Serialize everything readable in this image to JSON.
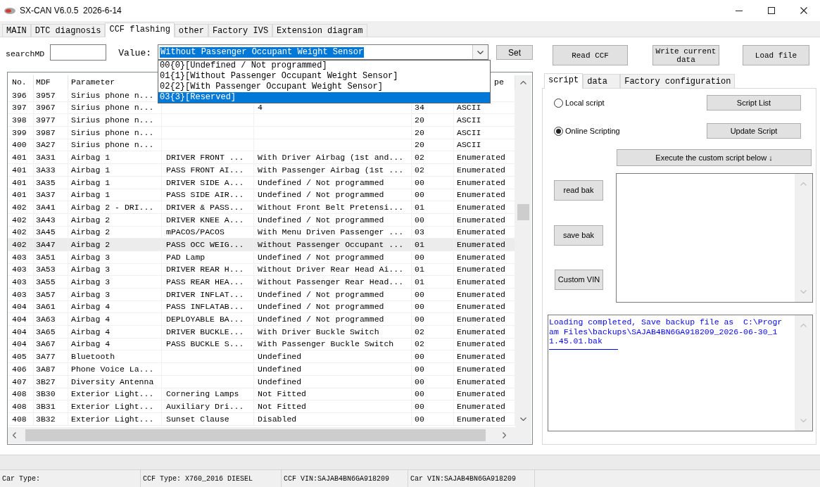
{
  "window": {
    "title": "SX-CAN V6.0.5  2026-6-14"
  },
  "tabs": [
    {
      "label": "MAIN",
      "selected": false
    },
    {
      "label": "DTC diagnosis",
      "selected": false
    },
    {
      "label": "CCF flashing",
      "selected": true
    },
    {
      "label": "other",
      "selected": false
    },
    {
      "label": "Factory IVS",
      "selected": false
    },
    {
      "label": "Extension diagram",
      "selected": false
    }
  ],
  "search": {
    "label": "searchMD"
  },
  "value_field": {
    "label": "Value:",
    "value": "Without Passenger Occupant Weight Sensor",
    "highlighted": true,
    "expanded": true,
    "options": [
      {
        "text": "00{0}[Undefined / Not programmed]",
        "selected": false
      },
      {
        "text": "01{1}[Without Passenger Occupant Weight Sensor]",
        "selected": false
      },
      {
        "text": "02{2}[With Passenger Occupant Weight Sensor]",
        "selected": false
      },
      {
        "text": "03{3}[Reserved]",
        "selected": true
      }
    ]
  },
  "set_button": "Set",
  "action_buttons": [
    "Read CCF",
    "Write current data",
    "Load file"
  ],
  "table": {
    "columns": {
      "no": "No.",
      "mdf": "MDF",
      "parameter": "Parameter",
      "column_7": "pe"
    },
    "rows": [
      {
        "no": "396",
        "mdf": "3957",
        "parameter": "Sirius phone n...",
        "selected": false
      },
      {
        "no": "397",
        "mdf": "3967",
        "parameter": "Sirius phone n...",
        "column_5": "4",
        "column_6": "34",
        "column_7": "ASCII",
        "selected": false
      },
      {
        "no": "398",
        "mdf": "3977",
        "parameter": "Sirius phone n...",
        "column_6": "20",
        "column_7": "ASCII",
        "selected": false
      },
      {
        "no": "399",
        "mdf": "3987",
        "parameter": "Sirius phone n...",
        "column_6": "20",
        "column_7": "ASCII",
        "selected": false
      },
      {
        "no": "400",
        "mdf": "3A27",
        "parameter": "Sirius phone n...",
        "column_6": "20",
        "column_7": "ASCII",
        "selected": false
      },
      {
        "no": "401",
        "mdf": "3A31",
        "parameter": "Airbag 1",
        "column_4": "DRIVER FRONT ...",
        "column_5": "With Driver Airbag (1st and...",
        "column_6": "02",
        "column_7": "Enumerated",
        "selected": false
      },
      {
        "no": "401",
        "mdf": "3A33",
        "parameter": "Airbag 1",
        "column_4": "PASS FRONT AI...",
        "column_5": "With Passenger Airbag (1st ...",
        "column_6": "02",
        "column_7": "Enumerated",
        "selected": false
      },
      {
        "no": "401",
        "mdf": "3A35",
        "parameter": "Airbag 1",
        "column_4": "DRIVER SIDE A...",
        "column_5": "Undefined / Not programmed",
        "column_6": "00",
        "column_7": "Enumerated",
        "selected": false
      },
      {
        "no": "401",
        "mdf": "3A37",
        "parameter": "Airbag 1",
        "column_4": "PASS SIDE AIR...",
        "column_5": "Undefined / Not programmed",
        "column_6": "00",
        "column_7": "Enumerated",
        "selected": false
      },
      {
        "no": "402",
        "mdf": "3A41",
        "parameter": "Airbag 2 - DRI...",
        "column_4": "DRIVER & PASS...",
        "column_5": "Without Front Belt Pretensi...",
        "column_6": "01",
        "column_7": "Enumerated",
        "selected": false
      },
      {
        "no": "402",
        "mdf": "3A43",
        "parameter": "Airbag 2",
        "column_4": "DRIVER KNEE A...",
        "column_5": "Undefined / Not programmed",
        "column_6": "00",
        "column_7": "Enumerated",
        "selected": false
      },
      {
        "no": "402",
        "mdf": "3A45",
        "parameter": "Airbag 2",
        "column_4": "mPACOS/PACOS",
        "column_5": "With Menu Driven Passenger ...",
        "column_6": "03",
        "column_7": "Enumerated",
        "selected": false
      },
      {
        "no": "402",
        "mdf": "3A47",
        "parameter": "Airbag 2",
        "column_4": "PASS OCC WEIG...",
        "column_5": "Without Passenger Occupant ...",
        "column_6": "01",
        "column_7": "Enumerated",
        "selected": true
      },
      {
        "no": "403",
        "mdf": "3A51",
        "parameter": "Airbag 3",
        "column_4": "PAD Lamp",
        "column_5": "Undefined / Not programmed",
        "column_6": "00",
        "column_7": "Enumerated",
        "selected": false
      },
      {
        "no": "403",
        "mdf": "3A53",
        "parameter": "Airbag 3",
        "column_4": "DRIVER REAR H...",
        "column_5": "Without Driver Rear Head Ai...",
        "column_6": "01",
        "column_7": "Enumerated",
        "selected": false
      },
      {
        "no": "403",
        "mdf": "3A55",
        "parameter": "Airbag 3",
        "column_4": "PASS REAR HEA...",
        "column_5": "Without Passenger Rear Head...",
        "column_6": "01",
        "column_7": "Enumerated",
        "selected": false
      },
      {
        "no": "403",
        "mdf": "3A57",
        "parameter": "Airbag 3",
        "column_4": "DRIVER INFLAT...",
        "column_5": "Undefined / Not programmed",
        "column_6": "00",
        "column_7": "Enumerated",
        "selected": false
      },
      {
        "no": "404",
        "mdf": "3A61",
        "parameter": "Airbag 4",
        "column_4": "PASS INFLATAB...",
        "column_5": "Undefined / Not programmed",
        "column_6": "00",
        "column_7": "Enumerated",
        "selected": false
      },
      {
        "no": "404",
        "mdf": "3A63",
        "parameter": "Airbag 4",
        "column_4": "DEPLOYABLE BA...",
        "column_5": "Undefined / Not programmed",
        "column_6": "00",
        "column_7": "Enumerated",
        "selected": false
      },
      {
        "no": "404",
        "mdf": "3A65",
        "parameter": "Airbag 4",
        "column_4": "DRIVER BUCKLE...",
        "column_5": "With Driver Buckle Switch",
        "column_6": "02",
        "column_7": "Enumerated",
        "selected": false
      },
      {
        "no": "404",
        "mdf": "3A67",
        "parameter": "Airbag 4",
        "column_4": "PASS BUCKLE S...",
        "column_5": "With Passenger Buckle Switch",
        "column_6": "02",
        "column_7": "Enumerated",
        "selected": false
      },
      {
        "no": "405",
        "mdf": "3A77",
        "parameter": "Bluetooth",
        "column_5": "Undefined",
        "column_6": "00",
        "column_7": "Enumerated",
        "selected": false
      },
      {
        "no": "406",
        "mdf": "3A87",
        "parameter": "Phone Voice La...",
        "column_5": "Undefined",
        "column_6": "00",
        "column_7": "Enumerated",
        "selected": false
      },
      {
        "no": "407",
        "mdf": "3B27",
        "parameter": "Diversity Antenna",
        "column_5": "Undefined",
        "column_6": "00",
        "column_7": "Enumerated",
        "selected": false
      },
      {
        "no": "408",
        "mdf": "3B30",
        "parameter": "Exterior Light...",
        "column_4": "Cornering Lamps",
        "column_5": "Not Fitted",
        "column_6": "00",
        "column_7": "Enumerated",
        "selected": false
      },
      {
        "no": "408",
        "mdf": "3B31",
        "parameter": "Exterior Light...",
        "column_4": "Auxiliary Dri...",
        "column_5": "Not Fitted",
        "column_6": "00",
        "column_7": "Enumerated",
        "selected": false
      },
      {
        "no": "408",
        "mdf": "3B32",
        "parameter": "Exterior Light...",
        "column_4": "Sunset Clause",
        "column_5": "Disabled",
        "column_6": "00",
        "column_7": "Enumerated",
        "selected": false
      }
    ]
  },
  "side_tabs": [
    {
      "label": "script",
      "selected": true
    },
    {
      "label": "data",
      "selected": false
    },
    {
      "label": "Factory configuration",
      "selected": false
    }
  ],
  "script_panel": {
    "sources": [
      {
        "label": "Local script",
        "selected": false
      },
      {
        "label": "Online Scripting",
        "selected": true
      }
    ],
    "script_buttons": [
      "Script List",
      "Update Script"
    ],
    "execute_button": "Execute the custom script below ↓",
    "backup_buttons": [
      "read bak",
      "save bak",
      "Custom VIN"
    ],
    "log": "Loading completed, Save backup file as  C:\\Program Files\\backups\\SAJAB4BN6GA918209_2026-06-30_11.45.01.bak"
  },
  "status_bar": [
    "Car Type:",
    "CCF Type: X760_2016 DIESEL",
    "CCF VIN:SAJAB4BN6GA918209",
    "Car VIN:SAJAB4BN6GA918209"
  ]
}
